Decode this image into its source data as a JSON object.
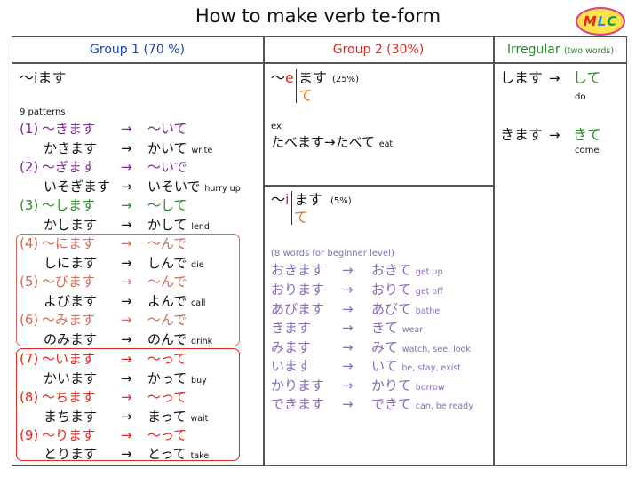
{
  "title": "How to make verb te-form",
  "logo": [
    "M",
    "L",
    "C"
  ],
  "headers": {
    "group1": "Group 1 (70 %)",
    "group2": "Group 2 (30%)",
    "irregular": "Irregular",
    "irregular_note": "(two words)"
  },
  "g1": {
    "heading": "〜iます",
    "patterns_label": "9 patterns",
    "rows": [
      {
        "num": "(1)",
        "from": "〜きます",
        "arrow": "→",
        "to": "〜いて"
      },
      {
        "ex": "かきます",
        "arrow": "→",
        "to": "かいて",
        "en": "write"
      },
      {
        "num": "(2)",
        "from": "〜ぎます",
        "arrow": "→",
        "to": "〜いで"
      },
      {
        "ex": "いそぎます",
        "arrow": "→",
        "to": "いそいで",
        "en": "hurry up"
      },
      {
        "num": "(3)",
        "from": "〜します",
        "arrow": "→",
        "to": "〜して"
      },
      {
        "ex": "かします",
        "arrow": "→",
        "to": "かして",
        "en": "lend"
      },
      {
        "num": "(4)",
        "from": "〜にます",
        "arrow": "→",
        "to": "〜んで"
      },
      {
        "ex": "しにます",
        "arrow": "→",
        "to": "しんで",
        "en": "die"
      },
      {
        "num": "(5)",
        "from": "〜びます",
        "arrow": "→",
        "to": "〜んで"
      },
      {
        "ex": "よびます",
        "arrow": "→",
        "to": "よんで",
        "en": "call"
      },
      {
        "num": "(6)",
        "from": "〜みます",
        "arrow": "→",
        "to": "〜んで"
      },
      {
        "ex": "のみます",
        "arrow": "→",
        "to": "のんで",
        "en": "drink"
      },
      {
        "num": "(7)",
        "from": "〜います",
        "arrow": "→",
        "to": "〜って"
      },
      {
        "ex": "かいます",
        "arrow": "→",
        "to": "かって",
        "en": "buy"
      },
      {
        "num": "(8)",
        "from": "〜ちます",
        "arrow": "→",
        "to": "〜って"
      },
      {
        "ex": "まちます",
        "arrow": "→",
        "to": "まって",
        "en": "wait"
      },
      {
        "num": "(9)",
        "from": "〜ります",
        "arrow": "→",
        "to": "〜って"
      },
      {
        "ex": "とります",
        "arrow": "→",
        "to": "とって",
        "en": "take"
      }
    ]
  },
  "g2": {
    "e_tilde": "〜",
    "e_vowel": "e",
    "e_masu": "ます",
    "e_pct": "(25%)",
    "e_te": "て",
    "ex_label": "ex",
    "ex_text": "たべます→たべて",
    "ex_en": "eat",
    "i_tilde": "〜",
    "i_vowel": "i",
    "i_masu": "ます",
    "i_pct": "(5%)",
    "i_te": "て",
    "i_note": "(8 words for beginner level)",
    "i_rows": [
      {
        "from": "おきます",
        "arrow": "→",
        "to": "おきて",
        "en": "get up"
      },
      {
        "from": "おります",
        "arrow": "→",
        "to": "おりて",
        "en": "get off"
      },
      {
        "from": "あびます",
        "arrow": "→",
        "to": "あびて",
        "en": "bathe"
      },
      {
        "from": "きます",
        "arrow": "→",
        "to": "きて",
        "en": "wear"
      },
      {
        "from": "みます",
        "arrow": "→",
        "to": "みて",
        "en": "watch, see, look"
      },
      {
        "from": "います",
        "arrow": "→",
        "to": "いて",
        "en": "be, stay, exist"
      },
      {
        "from": "かります",
        "arrow": "→",
        "to": "かりて",
        "en": "borrow"
      },
      {
        "from": "できます",
        "arrow": "→",
        "to": "できて",
        "en": "can, be ready"
      }
    ]
  },
  "irr": {
    "rows": [
      {
        "from": "します",
        "arrow": "→",
        "to": "して",
        "en": "do"
      },
      {
        "from": "きます",
        "arrow": "→",
        "to": "きて",
        "en": "come"
      }
    ]
  }
}
